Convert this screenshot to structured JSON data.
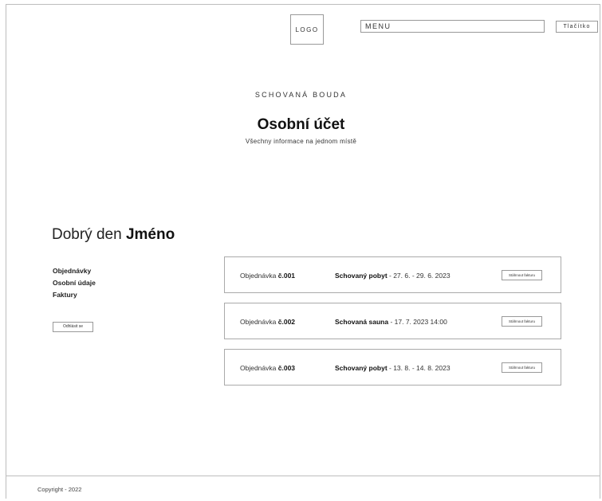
{
  "header": {
    "logo": "LOGO",
    "menu": "MENU",
    "button": "Tlačítko"
  },
  "hero": {
    "brand": "SCHOVANÁ BOUDA",
    "title": "Osobní účet",
    "subtitle": "Všechny informace na jednom místě"
  },
  "greeting": {
    "prefix": "Dobrý den",
    "name": "Jméno"
  },
  "sidebar": {
    "items": [
      {
        "label": "Objednávky"
      },
      {
        "label": "Osobní údaje"
      },
      {
        "label": "Faktury"
      }
    ],
    "logout": "Odhlásit se"
  },
  "orders": [
    {
      "label": "Objednávka",
      "number": "č.001",
      "product": "Schovaný pobyt",
      "detail": " - 27. 6. - 29. 6. 2023",
      "button": "Stáhnout fakturu"
    },
    {
      "label": "Objednávka",
      "number": "č.002",
      "product": "Schovaná sauna",
      "detail": " - 17. 7. 2023 14:00",
      "button": "Stáhnout fakturu"
    },
    {
      "label": "Objednávka",
      "number": "č.003",
      "product": "Schovaný pobyt",
      "detail": " - 13. 8. - 14. 8. 2023",
      "button": "Stáhnout fakturu"
    }
  ],
  "footer": {
    "copyright": "Copyright - 2022"
  }
}
